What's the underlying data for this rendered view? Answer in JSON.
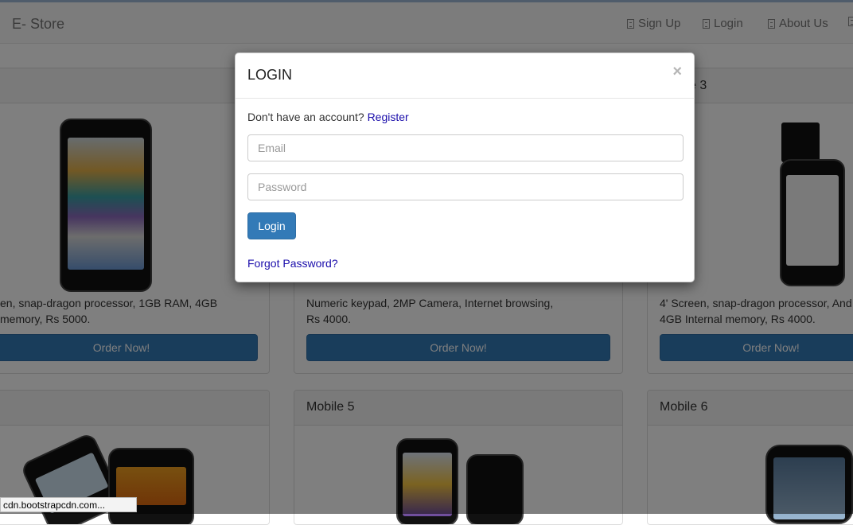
{
  "navbar": {
    "brand": "E- Store",
    "links": [
      {
        "label": "Sign Up",
        "icon": "file-icon"
      },
      {
        "label": "Login",
        "icon": "file-icon"
      },
      {
        "label": "About Us",
        "icon": "file-icon"
      }
    ]
  },
  "products": {
    "row1": [
      {
        "description_line1": "en, snap-dragon processor, 1GB RAM, 4GB",
        "description_line2": "memory, Rs 5000.",
        "button": "Order Now!"
      },
      {
        "description_line1": "Numeric keypad, 2MP Camera, Internet browsing,",
        "description_line2": "Rs 4000.",
        "button": "Order Now!"
      },
      {
        "title": "e 3",
        "description_line1": "4' Screen, snap-dragon processor, And",
        "description_line2": "4GB Internal memory, Rs 4000.",
        "button": "Order Now!"
      }
    ],
    "row2": [
      {
        "title": ""
      },
      {
        "title": "Mobile 5"
      },
      {
        "title": "Mobile 6"
      }
    ]
  },
  "modal": {
    "title": "LOGIN",
    "close": "×",
    "register_prompt": "Don't have an account?",
    "register_link": "Register",
    "email_placeholder": "Email",
    "password_placeholder": "Password",
    "login_button": "Login",
    "forgot_link": "Forgot Password?"
  },
  "statusbar": {
    "text": "cdn.bootstrapcdn.com..."
  },
  "colors": {
    "primary": "#337ab7",
    "link": "#1a0dab",
    "backdrop": "rgba(0,0,0,0.5)"
  }
}
